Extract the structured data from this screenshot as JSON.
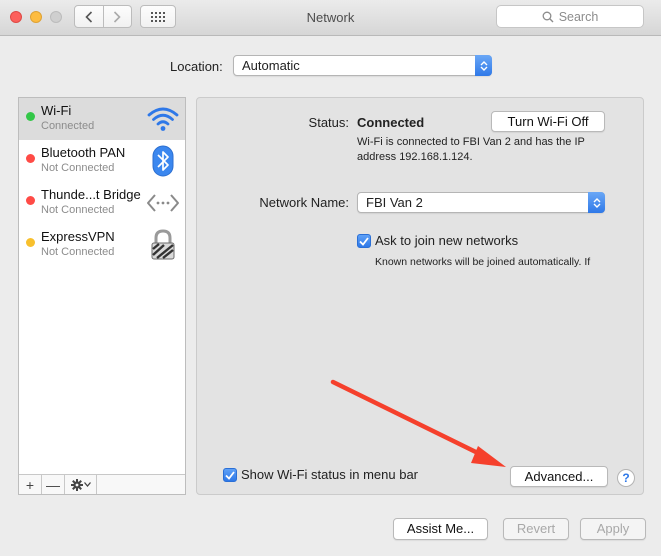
{
  "window": {
    "title": "Network",
    "search_placeholder": "Search",
    "controls": [
      "close-icon",
      "minimize-icon",
      "zoom-icon"
    ]
  },
  "location": {
    "label": "Location:",
    "value": "Automatic"
  },
  "services": [
    {
      "name": "Wi-Fi",
      "status": "Connected",
      "dot_color": "#33c748",
      "icon": "wifi-icon",
      "selected": true
    },
    {
      "name": "Bluetooth PAN",
      "status": "Not Connected",
      "dot_color": "#ff4b46",
      "icon": "bluetooth-icon"
    },
    {
      "name": "Thunde...t Bridge",
      "status": "Not Connected",
      "dot_color": "#ff4b46",
      "icon": "thunderbolt-bridge-icon"
    },
    {
      "name": "ExpressVPN",
      "status": "Not Connected",
      "dot_color": "#f8c02d",
      "icon": "vpn-lock-icon"
    }
  ],
  "sidebar_tools": {
    "add": "+",
    "remove": "—",
    "action": "gear-icon"
  },
  "detail": {
    "status_label": "Status:",
    "status_value": "Connected",
    "status_description": "Wi-Fi is connected to FBI Van 2 and has the IP address 192.168.1.124.",
    "turn_off_button": "Turn Wi-Fi Off",
    "network_name_label": "Network Name:",
    "network_name_value": "FBI Van 2",
    "ask_to_join": {
      "label": "Ask to join new networks",
      "checked": true
    },
    "ask_note": "Known networks will be joined automatically. If",
    "show_status": {
      "label": "Show Wi-Fi status in menu bar",
      "checked": true
    },
    "advanced_button": "Advanced...",
    "help_button": "?"
  },
  "footer": {
    "assist_button": "Assist Me...",
    "revert_button": "Revert",
    "apply_button": "Apply"
  },
  "colors": {
    "accent": "#2e78e8",
    "annotation_arrow": "#f5402c"
  }
}
